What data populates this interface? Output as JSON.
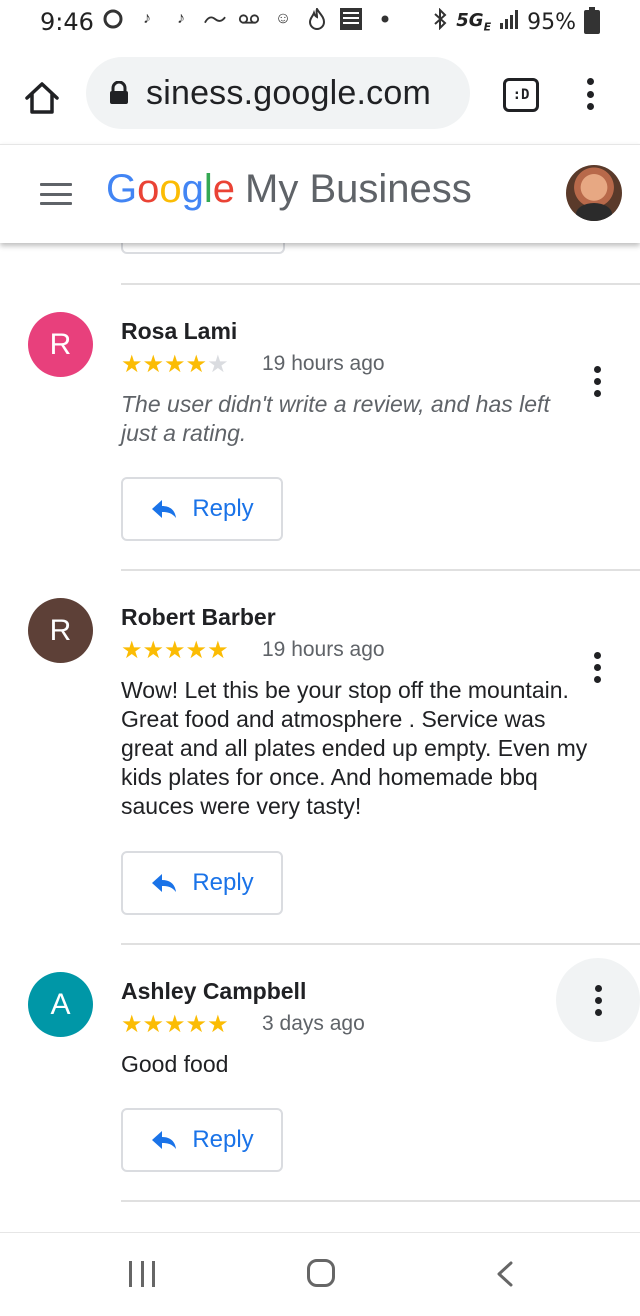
{
  "status_bar": {
    "time": "9:46",
    "network": "5G",
    "network_sub": "E",
    "battery": "95%",
    "left_icons": [
      "circle-icon",
      "tiktok-icon",
      "tiktok-icon",
      "dollar-store-icon",
      "voicemail-icon",
      "smiley-icon",
      "flame-icon",
      "weather-channel-icon",
      "dot-icon"
    ],
    "right_icons": [
      "bluetooth-icon",
      "signal-icon",
      "battery-icon"
    ]
  },
  "browser": {
    "url": "siness.google.com",
    "tab_badge": ":D"
  },
  "header": {
    "brand_google": [
      "G",
      "o",
      "o",
      "g",
      "l",
      "e"
    ],
    "product": "My Business"
  },
  "reviews": [
    {
      "initial": "R",
      "avatar_color": "#e8407c",
      "name": "Rosa Lami",
      "rating": 4,
      "time": "19 hours ago",
      "text": "The user didn't write a review, and has left just a rating.",
      "italic": true,
      "reply_label": "Reply"
    },
    {
      "initial": "R",
      "avatar_color": "#5d4037",
      "name": "Robert Barber",
      "rating": 5,
      "time": "19 hours ago",
      "text": "Wow! Let this be your stop off the mountain. Great food and atmosphere . Service was great and all plates ended up empty. Even my kids plates for once. And homemade bbq sauces were very tasty!",
      "italic": false,
      "reply_label": "Reply"
    },
    {
      "initial": "A",
      "avatar_color": "#0097a7",
      "name": "Ashley Campbell",
      "rating": 5,
      "time": "3 days ago",
      "text": "Good food",
      "italic": false,
      "reply_label": "Reply"
    }
  ],
  "colors": {
    "accent": "#1a73e8",
    "star": "#fbbc04",
    "star_empty": "#dadce0"
  }
}
